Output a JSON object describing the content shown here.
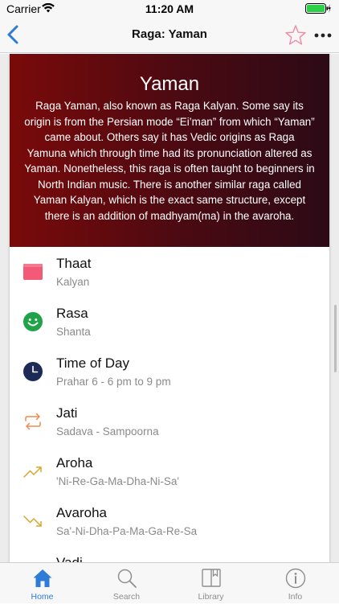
{
  "status_bar": {
    "carrier": "Carrier",
    "time": "11:20 AM"
  },
  "nav": {
    "title": "Raga: Yaman"
  },
  "hero": {
    "title": "Yaman",
    "description": "Raga Yaman, also known as Raga Kalyan. Some say its origin is from the Persian mode “Ei’man” from which “Yaman” came about. Others say it has Vedic origins as Raga Yamuna which through time had its pronunciation altered as Yaman. Nonetheless, this raga is often taught to beginners in North Indian music. There is another similar raga called Yaman Kalyan, which is the exact same structure, except there is an addition of madhyam(ma) in the avaroha."
  },
  "details": [
    {
      "title": "Thaat",
      "value": "Kalyan",
      "icon": "thaat-icon"
    },
    {
      "title": "Rasa",
      "value": "Shanta",
      "icon": "smiley-icon"
    },
    {
      "title": "Time of Day",
      "value": "Prahar 6 - 6 pm to 9 pm",
      "icon": "clock-icon"
    },
    {
      "title": "Jati",
      "value": "Sadava - Sampoorna",
      "icon": "swap-arrows-icon"
    },
    {
      "title": "Aroha",
      "value": "'Ni-Re-Ga-Ma-Dha-Ni-Sa'",
      "icon": "trending-up-icon"
    },
    {
      "title": "Avaroha",
      "value": "Sa'-Ni-Dha-Pa-Ma-Ga-Re-Sa",
      "icon": "trending-down-icon"
    },
    {
      "title": "Vadi",
      "value": "",
      "icon": ""
    }
  ],
  "tabs": [
    {
      "label": "Home",
      "icon": "home-icon",
      "active": true
    },
    {
      "label": "Search",
      "icon": "search-icon",
      "active": false
    },
    {
      "label": "Library",
      "icon": "book-icon",
      "active": false
    },
    {
      "label": "Info",
      "icon": "info-icon",
      "active": false
    }
  ],
  "colors": {
    "accent": "#2f7bd8",
    "star": "#f28aa6",
    "hero_start": "#7a0a0a",
    "hero_end": "#2c0a16",
    "thaat": "#f25a78",
    "rasa": "#21a34a",
    "clock": "#1c2a56",
    "jati": "#f08a4e",
    "aroha": "#d8a62a",
    "avaroha": "#d8a62a"
  }
}
